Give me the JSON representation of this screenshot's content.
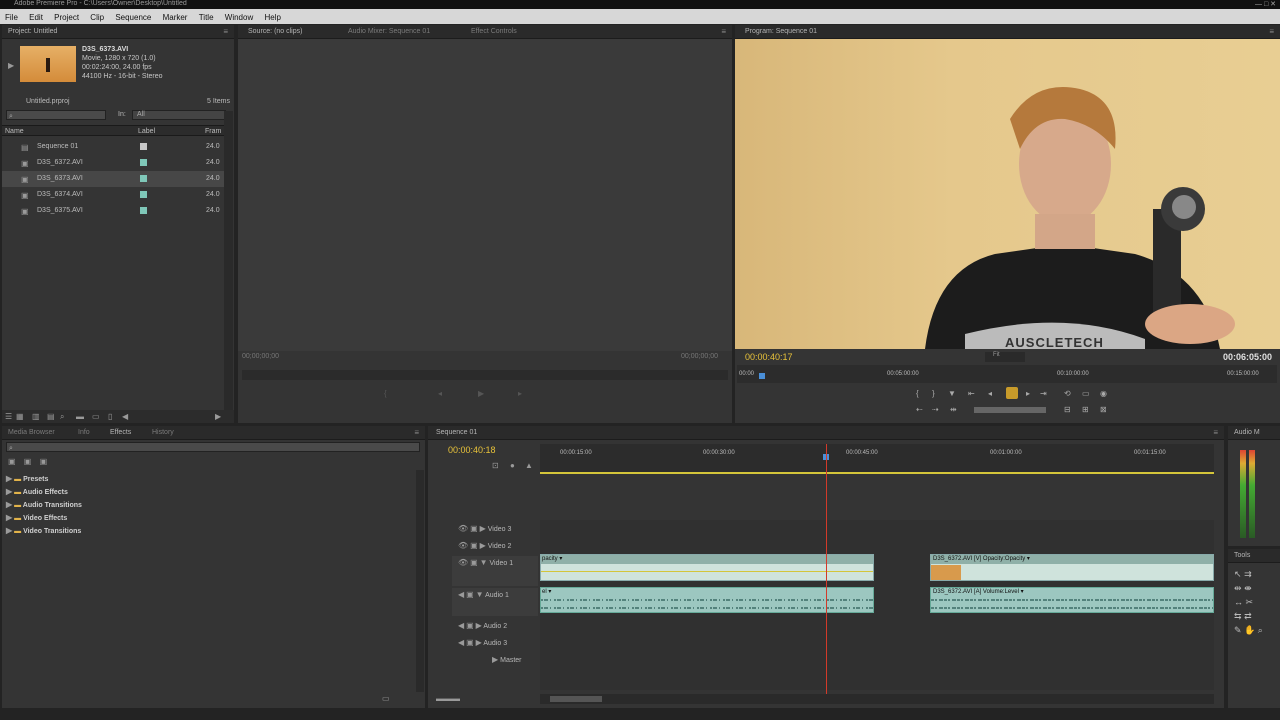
{
  "window": {
    "title": "Adobe Premiere Pro - C:\\Users\\Owner\\Desktop\\Untitled",
    "controls": "—  □  ✕"
  },
  "menu": [
    "File",
    "Edit",
    "Project",
    "Clip",
    "Sequence",
    "Marker",
    "Title",
    "Window",
    "Help"
  ],
  "project": {
    "tab": "Project: Untitled",
    "clip_name": "D3S_6373.AVI",
    "clip_info1": "Movie, 1280 x 720 (1.0)",
    "clip_info2": "00:02:24:00, 24.00 fps",
    "clip_info3": "44100 Hz - 16-bit - Stereo",
    "file": "Untitled.prproj",
    "items_count": "5 Items",
    "in_label": "In:",
    "in_value": "All",
    "col_name": "Name",
    "col_label": "Label",
    "col_frame": "Fram",
    "items": [
      {
        "name": "Sequence 01",
        "rate": "24.0"
      },
      {
        "name": "D3S_6372.AVI",
        "rate": "24.0"
      },
      {
        "name": "D3S_6373.AVI",
        "rate": "24.0"
      },
      {
        "name": "D3S_6374.AVI",
        "rate": "24.0"
      },
      {
        "name": "D3S_6375.AVI",
        "rate": "24.0"
      }
    ]
  },
  "source": {
    "tabs": [
      "Source: (no clips)",
      "Audio Mixer: Sequence 01",
      "Effect Controls"
    ],
    "tc_left": "00;00;00;00",
    "tc_right": "00;00;00;00"
  },
  "program": {
    "tab": "Program: Sequence 01",
    "tc_current": "00:00:40:17",
    "tc_duration": "00:06:05:00",
    "fit": "Fit",
    "ruler": [
      "00:00",
      "00:05:00:00",
      "00:10:00:00",
      "00:15:00:00"
    ],
    "shirt_text": "AUSCLETECH"
  },
  "effects": {
    "tabs": [
      "Media Browser",
      "Info",
      "Effects",
      "History"
    ],
    "folders": [
      "Presets",
      "Audio Effects",
      "Audio Transitions",
      "Video Effects",
      "Video Transitions"
    ]
  },
  "timeline": {
    "tab": "Sequence 01",
    "tc": "00:00:40:18",
    "ruler": [
      "00:00:15:00",
      "00:00:30:00",
      "00:00:45:00",
      "00:01:00:00",
      "00:01:15:00"
    ],
    "tracks": [
      "Video 3",
      "Video 2",
      "Video 1",
      "Audio 1",
      "Audio 2",
      "Audio 3",
      "Master"
    ],
    "clip_v1_label": "pacity ▾",
    "clip_v2_label": "D3S_6372.AVI [V]  Opacity:Opacity ▾",
    "clip_a1_label": "el ▾",
    "clip_a2_label": "D3S_6372.AVI [A]  Volume:Level ▾"
  },
  "audio_meters": {
    "tab": "Audio M"
  },
  "tools": {
    "tab": "Tools"
  }
}
